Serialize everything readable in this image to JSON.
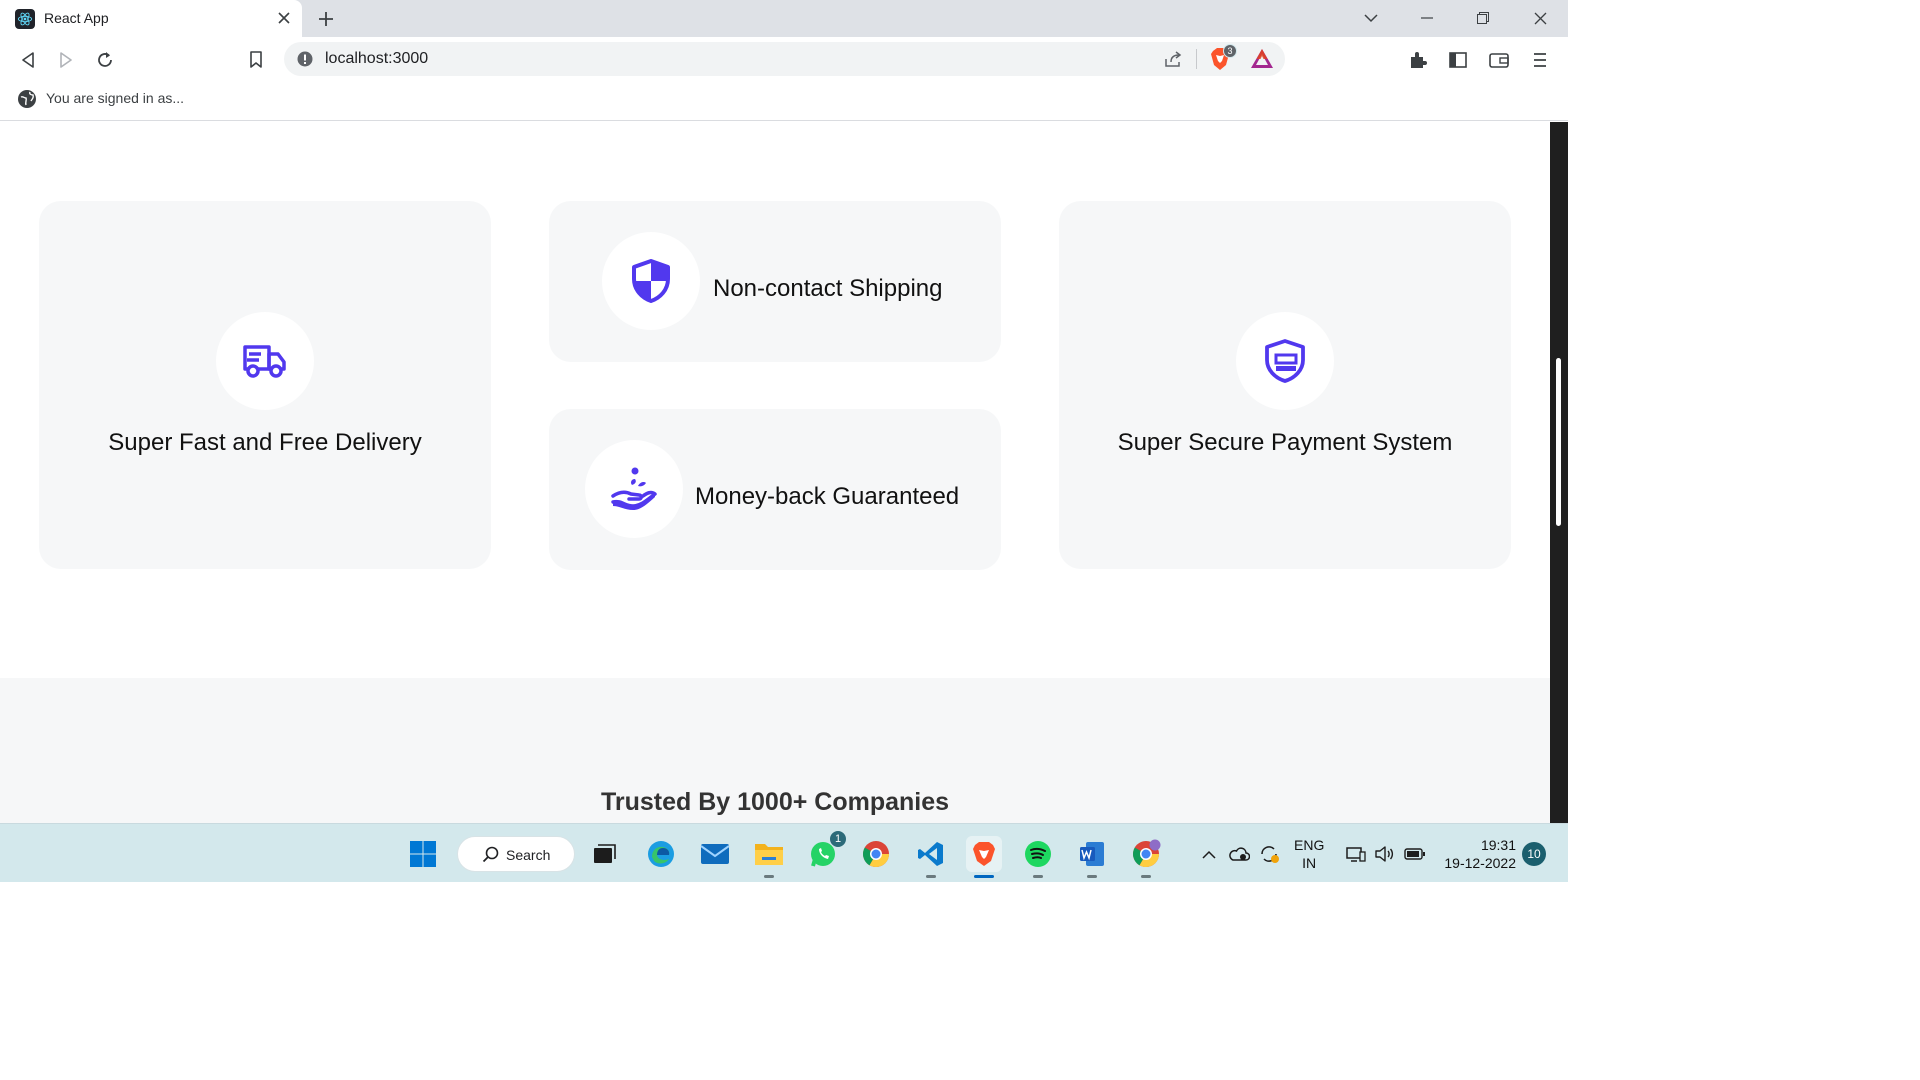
{
  "browser": {
    "tab_title": "React App",
    "url": "localhost:3000",
    "brave_shield_count": "3",
    "signed_in_text": "You are signed in as..."
  },
  "services": {
    "delivery": {
      "label": "Super Fast and Free Delivery",
      "icon": "truck-icon"
    },
    "shipping": {
      "label": "Non-contact Shipping",
      "icon": "shield-icon"
    },
    "moneyback": {
      "label": "Money-back Guaranteed",
      "icon": "hand-money-icon"
    },
    "payment": {
      "label": "Super Secure Payment System",
      "icon": "secure-payment-icon"
    },
    "accent_color": "#5138ee"
  },
  "trusted": {
    "title": "Trusted By 1000+ Companies"
  },
  "taskbar": {
    "search_label": "Search",
    "whatsapp_badge": "1",
    "language_line1": "ENG",
    "language_line2": "IN",
    "time": "19:31",
    "date": "19-12-2022",
    "notification_count": "10"
  }
}
